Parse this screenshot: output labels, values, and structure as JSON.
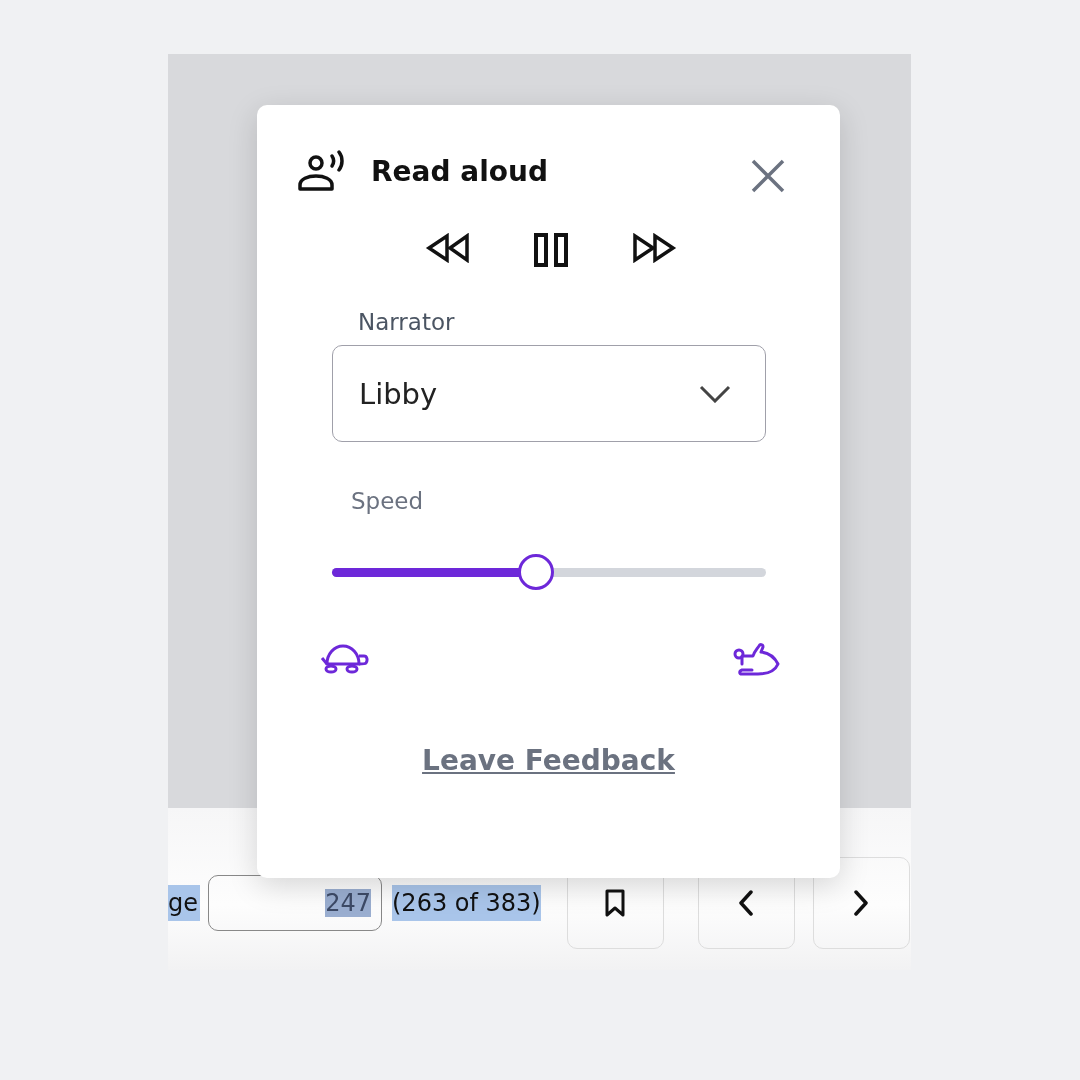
{
  "dialog": {
    "title": "Read aloud",
    "playing": true,
    "narrator": {
      "label": "Narrator",
      "value": "Libby"
    },
    "speed": {
      "label": "Speed",
      "level": 0.47
    },
    "feedback_link": "Leave Feedback"
  },
  "page_bar": {
    "label": "ge",
    "page_input": "247",
    "page_count": "(263 of 383)",
    "text_selected": true
  }
}
